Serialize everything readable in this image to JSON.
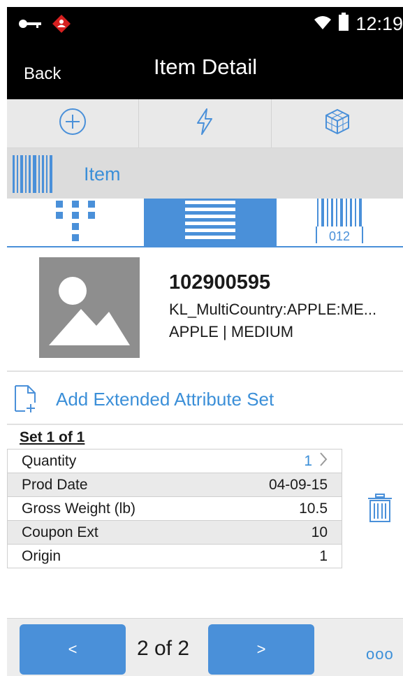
{
  "status_bar": {
    "time": "12:19"
  },
  "header": {
    "back_label": "Back",
    "title": "Item Detail"
  },
  "actions": [
    {
      "icon": "add-circle-icon"
    },
    {
      "icon": "lightning-icon"
    },
    {
      "icon": "cube-icon"
    }
  ],
  "scan": {
    "label": "Item"
  },
  "view_tabs": [
    {
      "icon": "grid-view-icon",
      "active": false
    },
    {
      "icon": "list-view-icon",
      "active": true
    },
    {
      "icon": "barcode-view-icon",
      "active": false,
      "caption": "012"
    }
  ],
  "item": {
    "id": "102900595",
    "description": "KL_MultiCountry:APPLE:ME...",
    "subtitle": "APPLE | MEDIUM"
  },
  "add_attribute_label": "Add Extended Attribute Set",
  "set_label": "Set 1 of 1",
  "attributes": [
    {
      "label": "Quantity",
      "value": "1"
    },
    {
      "label": "Prod Date",
      "value": "04-09-15"
    },
    {
      "label": "Gross Weight (lb)",
      "value": "10.5"
    },
    {
      "label": "Coupon Ext",
      "value": "10"
    },
    {
      "label": "Origin",
      "value": "1"
    }
  ],
  "footer": {
    "prev_label": "<",
    "page_text": "2 of 2",
    "next_label": ">",
    "more_label": "ooo"
  },
  "colors": {
    "accent": "#4a90d9",
    "link": "#3b8fd8",
    "bar": "#000000"
  }
}
